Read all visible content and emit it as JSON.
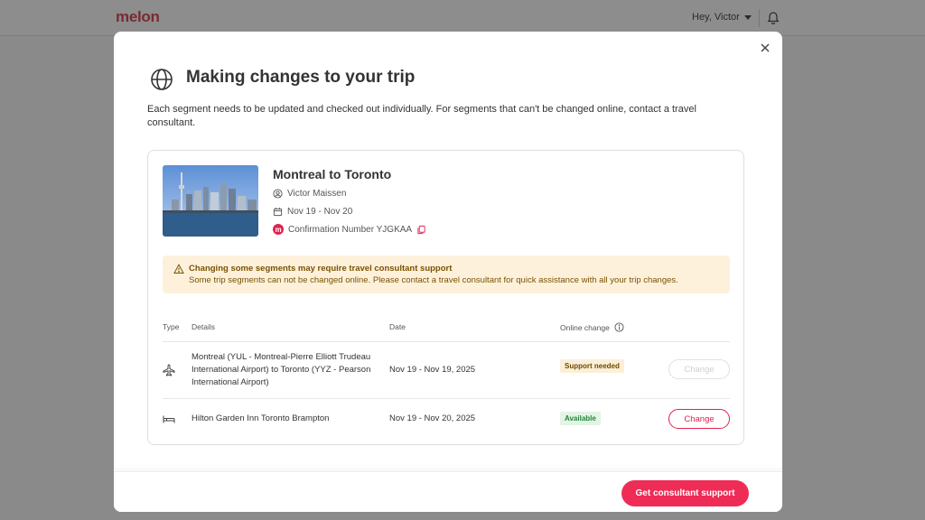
{
  "app": {
    "logo": "melon",
    "greeting": "Hey, Victor"
  },
  "modal": {
    "title": "Making changes to your trip",
    "intro": "Each segment needs to be updated and checked out individually. For segments that can't be changed online, contact a travel consultant."
  },
  "trip": {
    "title": "Montreal to Toronto",
    "traveler": "Victor Maissen",
    "dates": "Nov 19 - Nov 20",
    "confirmation": "Confirmation Number YJGKAA",
    "badge": "m"
  },
  "notice": {
    "title": "Changing some segments may require travel consultant support",
    "text": "Some trip segments can not be changed online. Please contact a travel consultant for quick assistance with all your trip changes."
  },
  "table": {
    "headers": {
      "type": "Type",
      "details": "Details",
      "date": "Date",
      "online": "Online change"
    },
    "rows": [
      {
        "icon": "plane-icon",
        "details": "Montreal (YUL - Montreal-Pierre Elliott Trudeau International Airport) to Toronto (YYZ - Pearson International Airport)",
        "date": "Nov 19 - Nov 19, 2025",
        "status": "Support needed",
        "action": "Change"
      },
      {
        "icon": "bed-icon",
        "details": "Hilton Garden Inn Toronto Brampton",
        "date": "Nov 19 - Nov 20, 2025",
        "status": "Available",
        "action": "Change"
      }
    ]
  },
  "footer": {
    "primary_label": "Get consultant support"
  },
  "colors": {
    "accent": "#ee2c55",
    "warning_bg": "#fdf1dc",
    "success": "#22853a"
  }
}
